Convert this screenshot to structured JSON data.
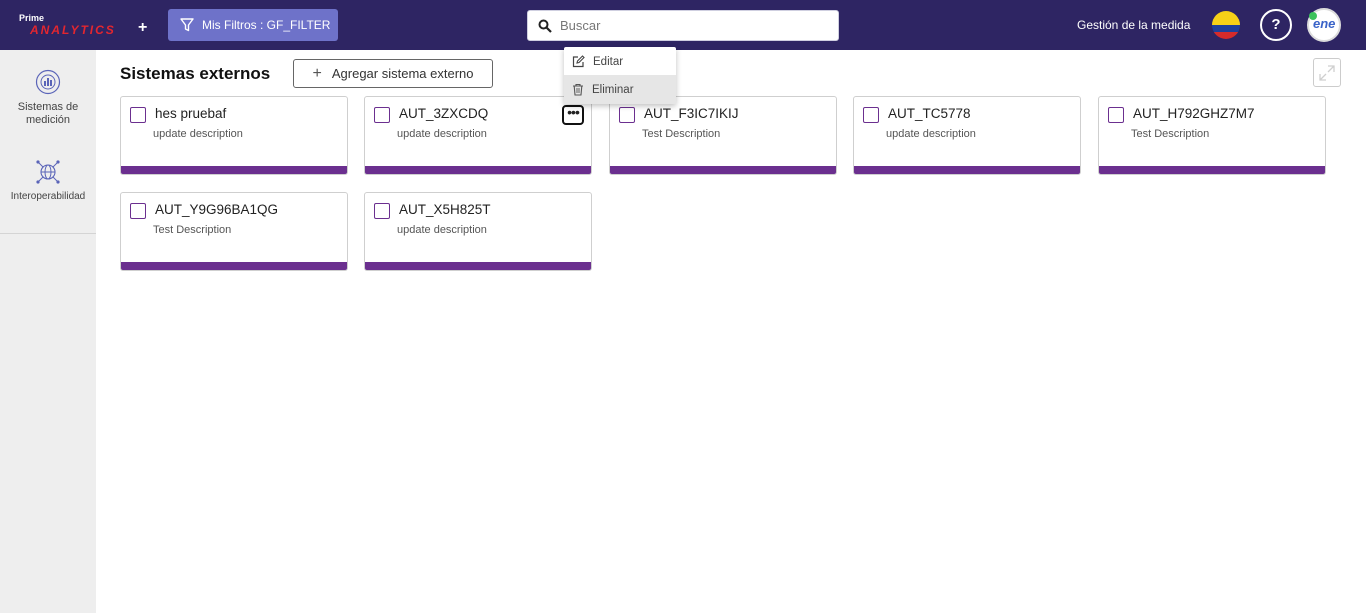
{
  "header": {
    "logo_top": "Prime",
    "logo_main": "ANALYTICS",
    "logo_plus": "+",
    "filter_label": "Mis Filtros : GF_FILTER",
    "search_placeholder": "Buscar",
    "context_label": "Gestión de la medida",
    "help_label": "?",
    "avatar_text": "ene"
  },
  "sidebar": {
    "items": [
      {
        "label": "Sistemas de medición",
        "icon": "chart-globe-icon"
      },
      {
        "label": "Interoperabilidad",
        "icon": "network-globe-icon"
      }
    ]
  },
  "main": {
    "title": "Sistemas externos",
    "add_button": "Agregar sistema externo",
    "cards": [
      {
        "name": "hes pruebaf",
        "description": "update description"
      },
      {
        "name": "AUT_3ZXCDQ",
        "description": "update description"
      },
      {
        "name": "AUT_F3IC7IKIJ",
        "description": "Test Description"
      },
      {
        "name": "AUT_TC5778",
        "description": "update description"
      },
      {
        "name": "AUT_H792GHZ7M7",
        "description": "Test Description"
      },
      {
        "name": "AUT_Y9G96BA1QG",
        "description": "Test Description"
      },
      {
        "name": "AUT_X5H825T",
        "description": "update description"
      }
    ]
  },
  "context_menu": {
    "items": [
      {
        "label": "Editar",
        "icon": "edit-icon"
      },
      {
        "label": "Eliminar",
        "icon": "trash-icon"
      }
    ]
  },
  "colors": {
    "header_bg": "#2e2563",
    "filter_bg": "#6e72c9",
    "card_accent": "#6b2f8f",
    "logo_red": "#e3262f"
  }
}
